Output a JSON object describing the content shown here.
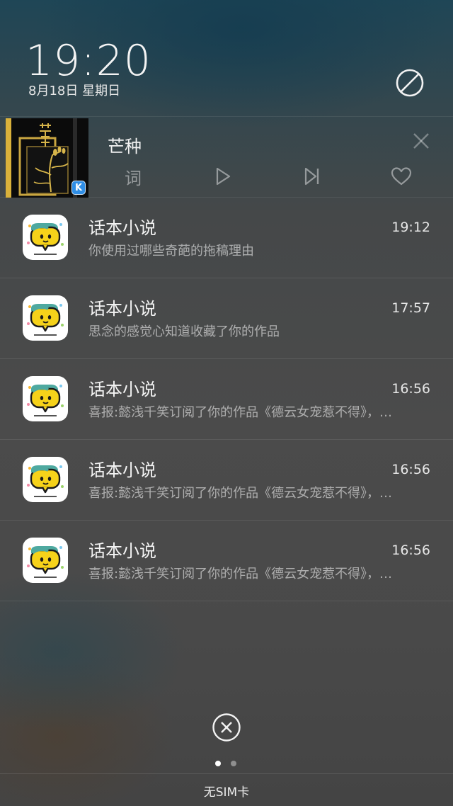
{
  "header": {
    "time": "19:20",
    "date": "8月18日 星期日"
  },
  "music": {
    "song_title": "芒种",
    "lyrics_label": "词",
    "album_badge": "K",
    "album_art_text": "芒种"
  },
  "notifications": [
    {
      "app": "话本小说",
      "time": "19:12",
      "body": "你使用过哪些奇葩的拖稿理由"
    },
    {
      "app": "话本小说",
      "time": "17:57",
      "body": "思念的感觉心知道收藏了你的作品"
    },
    {
      "app": "话本小说",
      "time": "16:56",
      "body": "喜报:懿浅千笑订阅了你的作品《德云女宠惹不得》，…"
    },
    {
      "app": "话本小说",
      "time": "16:56",
      "body": "喜报:懿浅千笑订阅了你的作品《德云女宠惹不得》，…"
    },
    {
      "app": "话本小说",
      "time": "16:56",
      "body": "喜报:懿浅千笑订阅了你的作品《德云女宠惹不得》，…"
    }
  ],
  "footer": {
    "sim_status": "无SIM卡",
    "page_count": 2,
    "active_page": 1
  },
  "icons": {
    "dnd": "do-not-disturb-icon",
    "close": "close-icon",
    "play": "play-icon",
    "next": "skip-next-icon",
    "favorite": "heart-icon",
    "clear_all": "clear-all-icon"
  },
  "colors": {
    "album_accent": "#d9b13b",
    "badge_blue": "#2f8ee6",
    "app_icon_yellow": "#f6d21a",
    "app_icon_teal": "#4ea9a0"
  }
}
